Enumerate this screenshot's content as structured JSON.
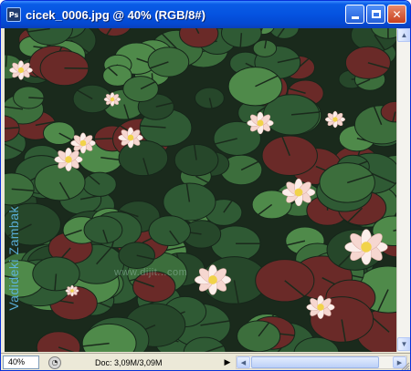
{
  "window": {
    "title": "cicek_0006.jpg @ 40% (RGB/8#)",
    "app_icon": "Ps",
    "buttons": {
      "minimize": "minimize-icon",
      "maximize": "maximize-icon",
      "close": "✕"
    }
  },
  "image": {
    "subject": "water lilies on lily pads",
    "watermark_vertical": "Vadideki Zambak",
    "watermark_horizontal": "www.dijit...com",
    "colors": {
      "water": "#1a2a1c",
      "pad_dark": "#2f5a34",
      "pad_light": "#4f8a4a",
      "pad_red": "#6a2a28",
      "flower_petal": "#f6d7d0",
      "flower_center": "#f1d34a"
    }
  },
  "statusbar": {
    "zoom": "40%",
    "doc_info": "Doc: 3,09M/3,09M",
    "info_arrow": "▶",
    "scroll_left": "◀",
    "scroll_right": "▶",
    "nav_icon": "navigator-icon"
  },
  "vscroll": {
    "up": "▲",
    "down": "▼"
  },
  "accent_colors": {
    "titlebar": "#0553e0",
    "close_button": "#c8401e"
  }
}
